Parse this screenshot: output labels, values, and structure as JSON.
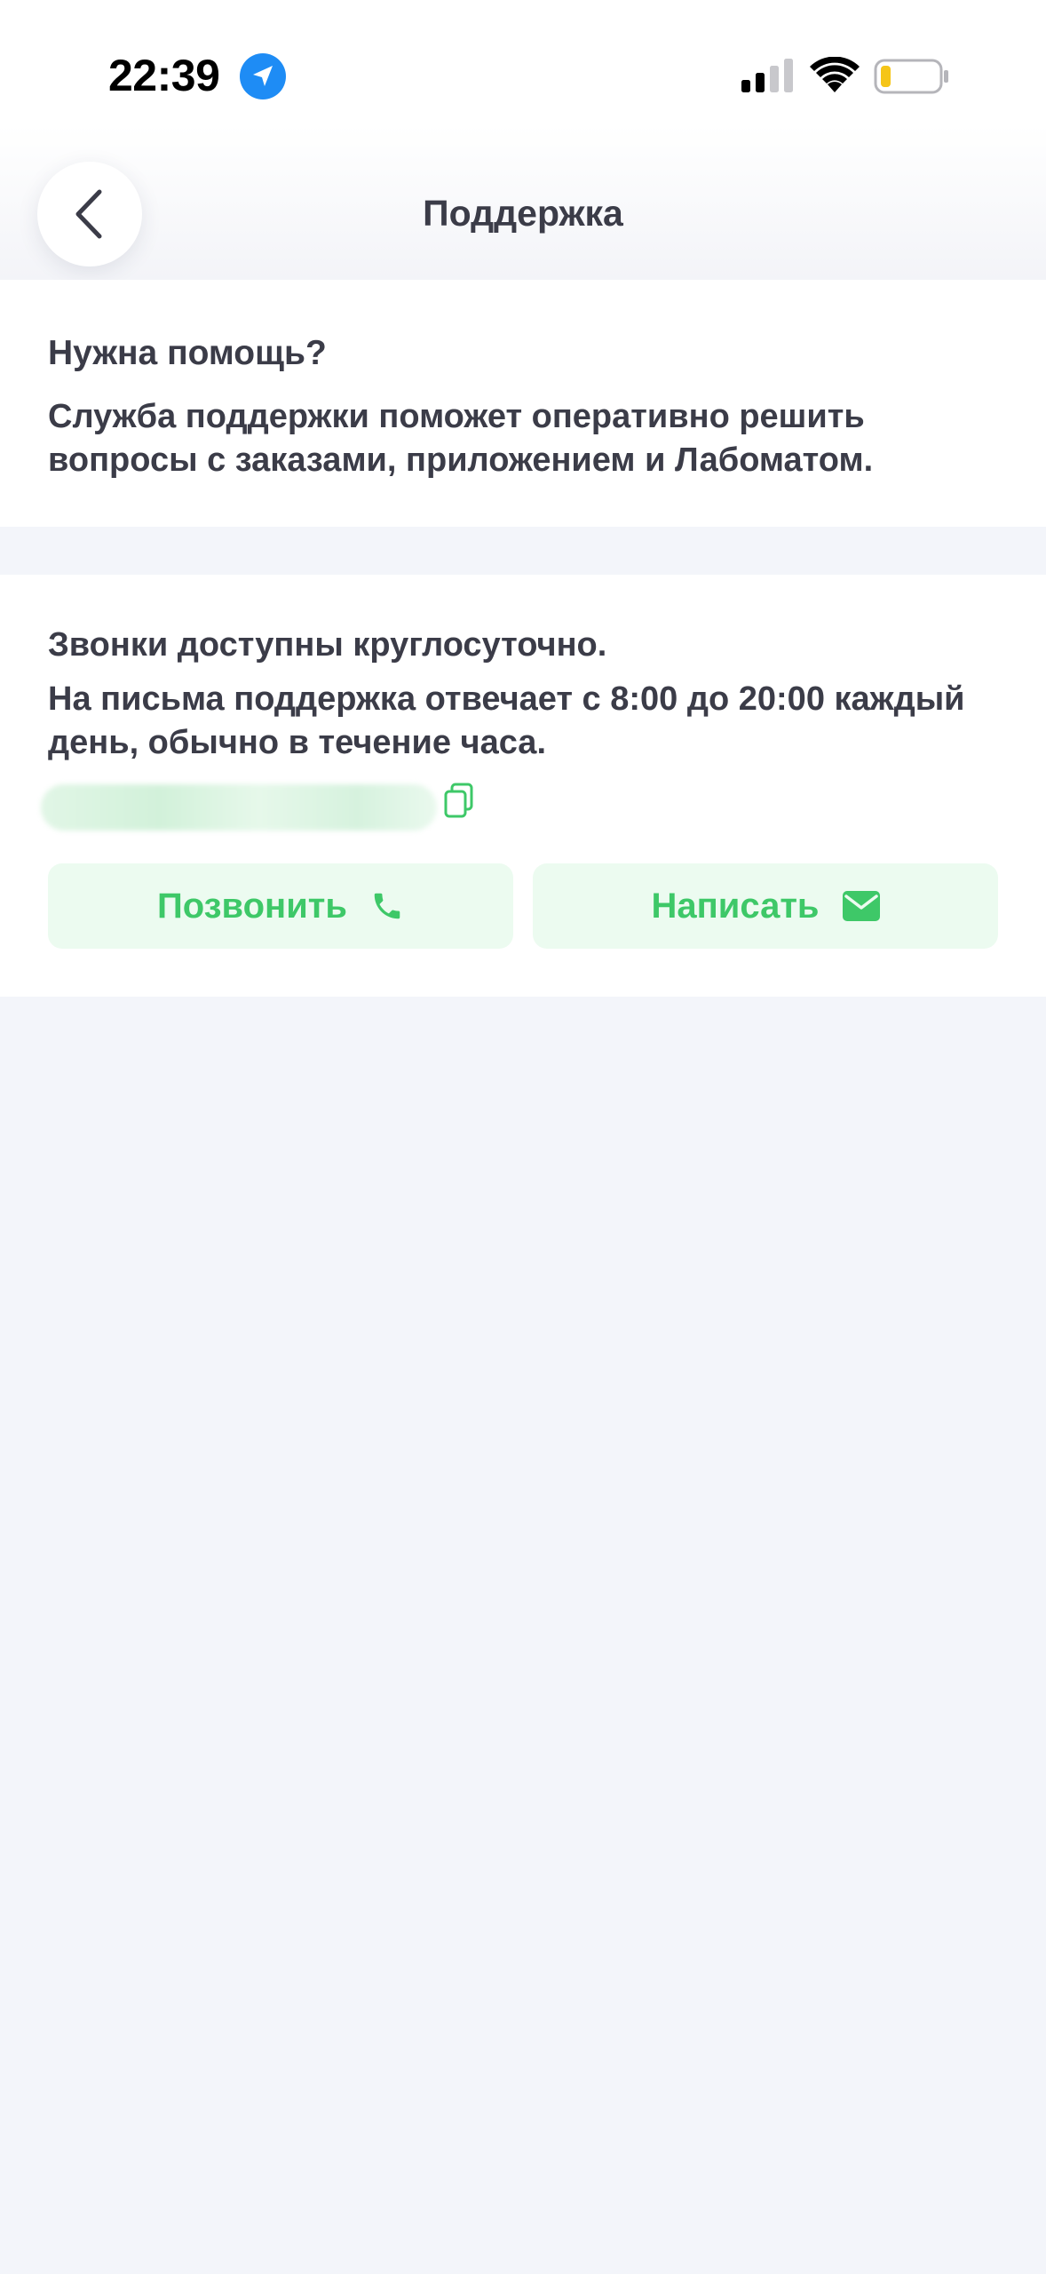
{
  "status_bar": {
    "time": "22:39",
    "icons": [
      "location-arrow-icon",
      "cellular-signal-icon",
      "wifi-icon",
      "battery-low-icon"
    ]
  },
  "header": {
    "title": "Поддержка",
    "back_icon": "chevron-left-icon"
  },
  "help": {
    "title": "Нужна помощь?",
    "text": "Служба поддержки поможет оперативно решить вопросы с заказами, приложением и Лабоматом."
  },
  "contacts": {
    "calls_text": "Звонки доступны круглосуточно.",
    "mail_text": "На письма поддержка отвечает с 8:00 до 20:00 каждый день, обычно в течение часа.",
    "copy_icon": "copy-icon"
  },
  "actions": {
    "call_label": "Позвонить",
    "call_icon": "phone-icon",
    "write_label": "Написать",
    "write_icon": "envelope-icon"
  },
  "colors": {
    "accent_green": "#3ec868",
    "button_bg": "#ecfbf0",
    "text": "#3b3c48",
    "background": "#f3f5fa",
    "location_blue": "#1e8cf5",
    "battery_yellow": "#f5c518"
  }
}
